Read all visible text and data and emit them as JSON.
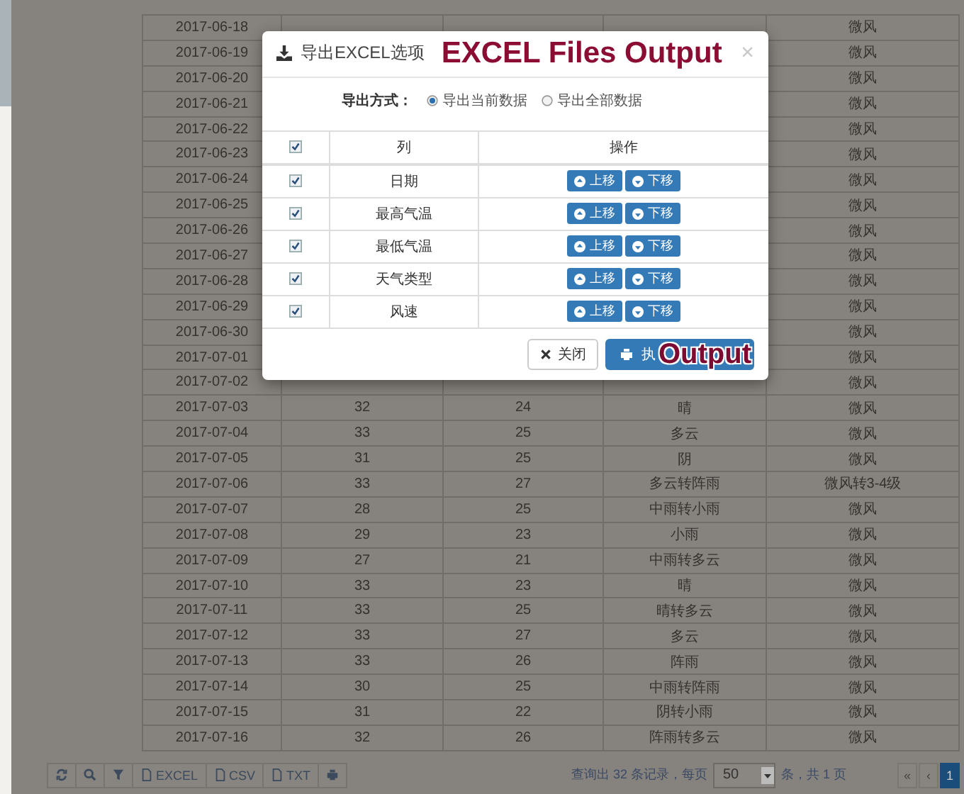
{
  "table": {
    "rows": [
      {
        "date": "2017-06-18",
        "wind": "微风"
      },
      {
        "date": "2017-06-19",
        "wind": "微风"
      },
      {
        "date": "2017-06-20",
        "wind": "微风"
      },
      {
        "date": "2017-06-21",
        "wind": "微风"
      },
      {
        "date": "2017-06-22",
        "wind": "微风"
      },
      {
        "date": "2017-06-23",
        "wind": "微风"
      },
      {
        "date": "2017-06-24",
        "wind": "微风"
      },
      {
        "date": "2017-06-25",
        "wind": "微风"
      },
      {
        "date": "2017-06-26",
        "wind": "微风"
      },
      {
        "date": "2017-06-27",
        "wind": "微风"
      },
      {
        "date": "2017-06-28",
        "wind": "微风"
      },
      {
        "date": "2017-06-29",
        "wind": "微风"
      },
      {
        "date": "2017-06-30",
        "wind": "微风"
      },
      {
        "date": "2017-07-01",
        "wind": "微风"
      },
      {
        "date": "2017-07-02",
        "wind": "微风"
      },
      {
        "date": "2017-07-03",
        "high": "32",
        "low": "24",
        "weather": "晴",
        "wind": "微风"
      },
      {
        "date": "2017-07-04",
        "high": "33",
        "low": "25",
        "weather": "多云",
        "wind": "微风"
      },
      {
        "date": "2017-07-05",
        "high": "31",
        "low": "25",
        "weather": "阴",
        "wind": "微风"
      },
      {
        "date": "2017-07-06",
        "high": "33",
        "low": "27",
        "weather": "多云转阵雨",
        "wind": "微风转3-4级"
      },
      {
        "date": "2017-07-07",
        "high": "28",
        "low": "25",
        "weather": "中雨转小雨",
        "wind": "微风"
      },
      {
        "date": "2017-07-08",
        "high": "29",
        "low": "23",
        "weather": "小雨",
        "wind": "微风"
      },
      {
        "date": "2017-07-09",
        "high": "27",
        "low": "21",
        "weather": "中雨转多云",
        "wind": "微风"
      },
      {
        "date": "2017-07-10",
        "high": "33",
        "low": "23",
        "weather": "晴",
        "wind": "微风"
      },
      {
        "date": "2017-07-11",
        "high": "33",
        "low": "25",
        "weather": "晴转多云",
        "wind": "微风"
      },
      {
        "date": "2017-07-12",
        "high": "33",
        "low": "27",
        "weather": "多云",
        "wind": "微风"
      },
      {
        "date": "2017-07-13",
        "high": "33",
        "low": "26",
        "weather": "阵雨",
        "wind": "微风"
      },
      {
        "date": "2017-07-14",
        "high": "30",
        "low": "25",
        "weather": "中雨转阵雨",
        "wind": "微风"
      },
      {
        "date": "2017-07-15",
        "high": "31",
        "low": "22",
        "weather": "阴转小雨",
        "wind": "微风"
      },
      {
        "date": "2017-07-16",
        "high": "32",
        "low": "26",
        "weather": "阵雨转多云",
        "wind": "微风"
      }
    ]
  },
  "toolbar": {
    "buttons": [
      {
        "kind": "refresh"
      },
      {
        "kind": "search"
      },
      {
        "kind": "filter"
      },
      {
        "kind": "export",
        "label": "EXCEL"
      },
      {
        "kind": "export",
        "label": "CSV"
      },
      {
        "kind": "export",
        "label": "TXT"
      },
      {
        "kind": "print"
      }
    ]
  },
  "pagination": {
    "summary": "查询出 32 条记录，每页",
    "page_size": "50",
    "suffix": "条，共 1 页",
    "buttons": [
      {
        "label": "«",
        "selected": false
      },
      {
        "label": "‹",
        "selected": false
      },
      {
        "label": "1",
        "selected": true
      }
    ]
  },
  "modal": {
    "title": "导出EXCEL选项",
    "annotation": "EXCEL Files Output",
    "close": "×",
    "export_mode": {
      "label": "导出方式：",
      "options": [
        {
          "label": "导出当前数据",
          "selected": true
        },
        {
          "label": "导出全部数据",
          "selected": false
        }
      ]
    },
    "columns_table": {
      "header_checked": true,
      "headers": [
        "列",
        "操作"
      ],
      "rows": [
        {
          "name": "日期",
          "checked": true,
          "actions": [
            "上移",
            "下移"
          ]
        },
        {
          "name": "最高气温",
          "checked": true,
          "actions": [
            "上移",
            "下移"
          ]
        },
        {
          "name": "最低气温",
          "checked": true,
          "actions": [
            "上移",
            "下移"
          ]
        },
        {
          "name": "天气类型",
          "checked": true,
          "actions": [
            "上移",
            "下移"
          ]
        },
        {
          "name": "风速",
          "checked": true,
          "actions": [
            "上移",
            "下移"
          ]
        }
      ]
    },
    "footer": {
      "close_button": "关闭",
      "execute_button": "执",
      "annotation": "Output"
    }
  }
}
